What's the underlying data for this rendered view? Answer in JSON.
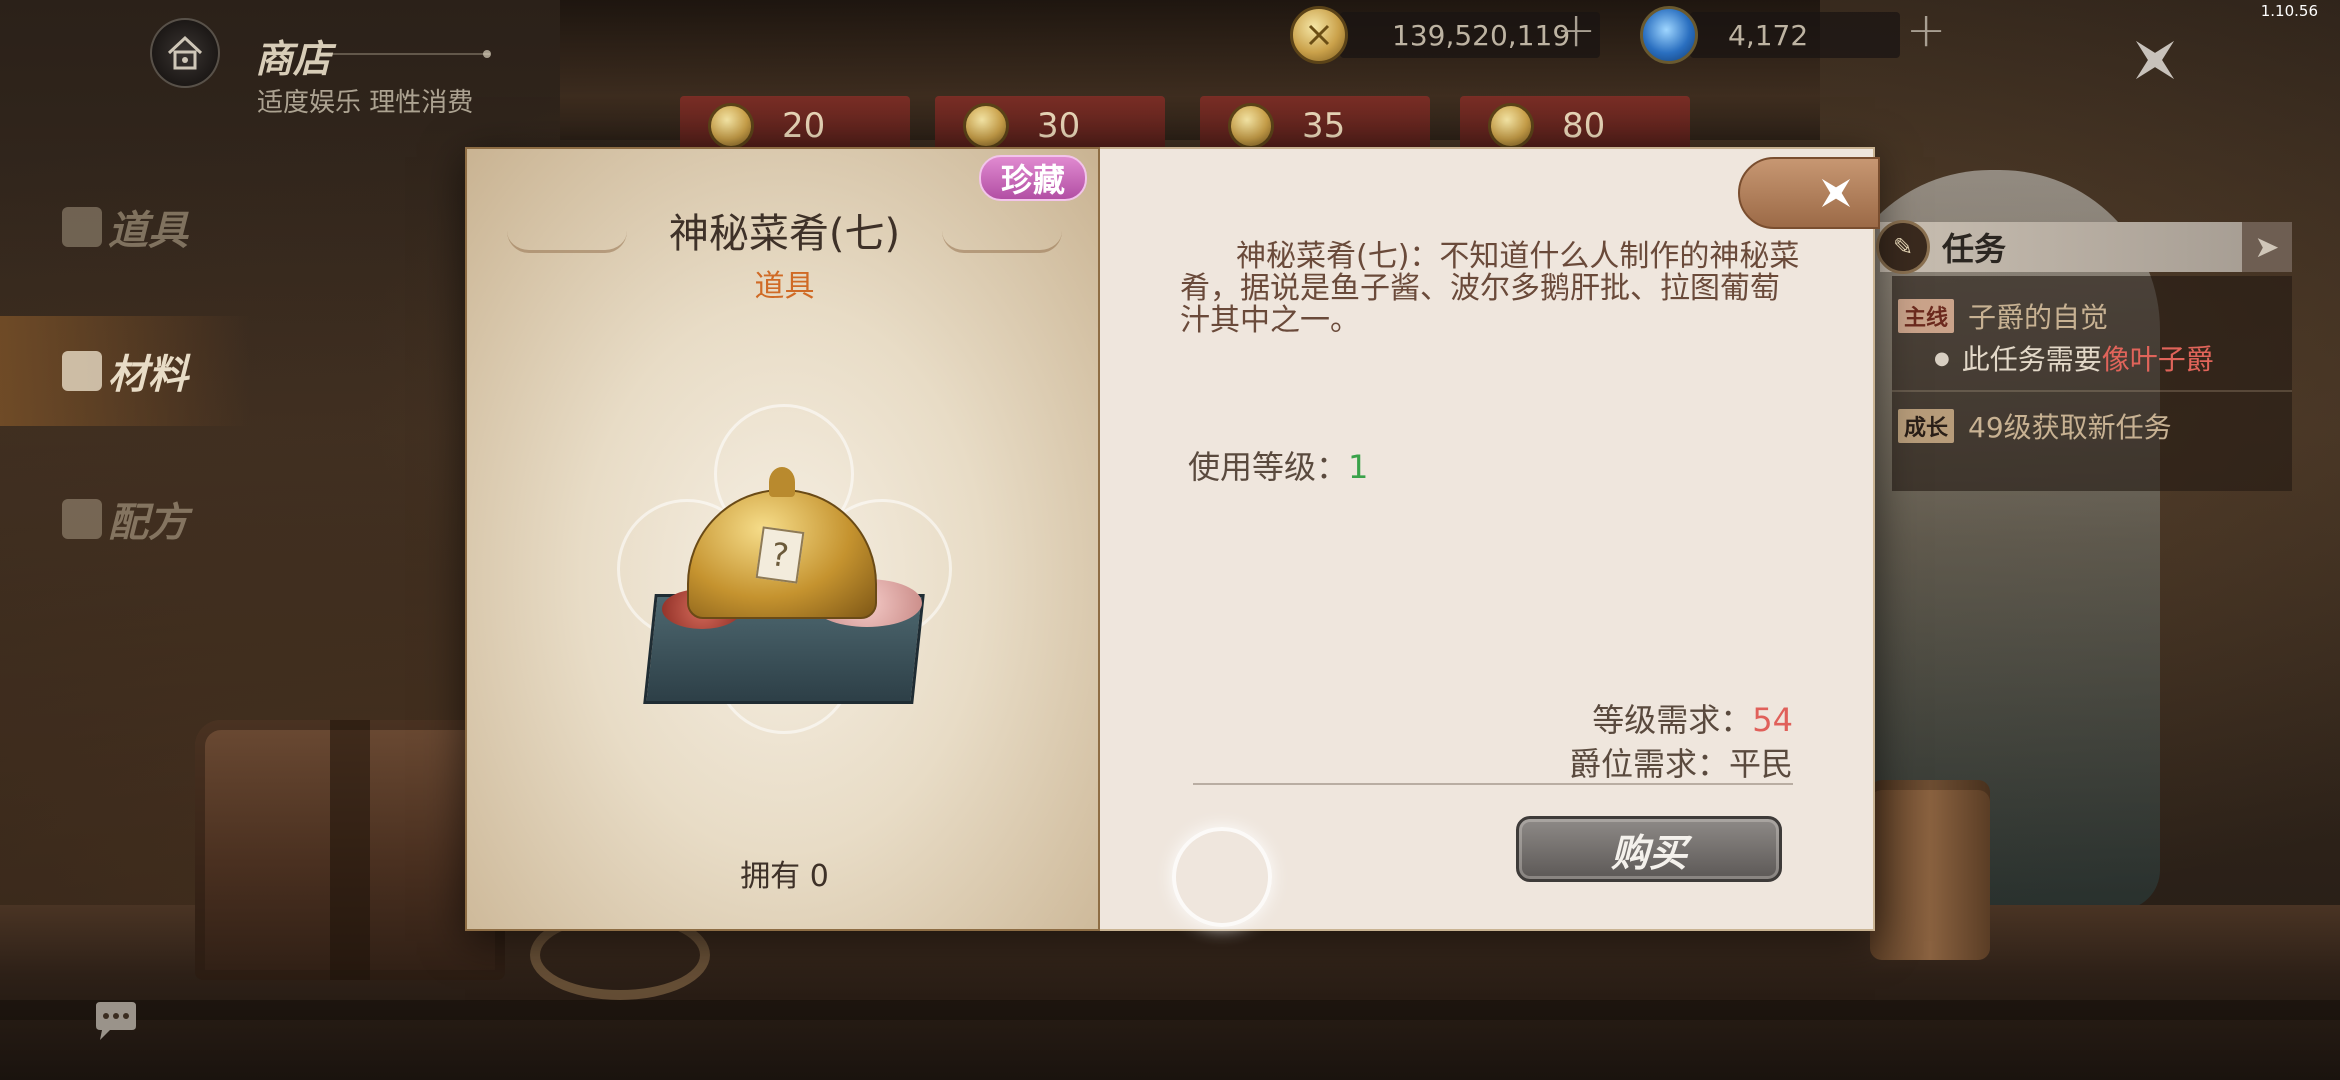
{
  "version": "1.10.56",
  "header": {
    "title": "商店",
    "subtitle": "适度娱乐 理性消费"
  },
  "currency": {
    "gold": "139,520,119",
    "gems": "4,172"
  },
  "price_tabs": [
    "20",
    "30",
    "35",
    "80"
  ],
  "nav": {
    "items": [
      {
        "label": "道具",
        "icon": "bag-icon"
      },
      {
        "label": "材料",
        "icon": "book-icon",
        "active": true
      },
      {
        "label": "配方",
        "icon": "scroll-icon"
      }
    ]
  },
  "task_panel": {
    "title": "任务",
    "main_tag": "主线",
    "main_title": "子爵的自觉",
    "main_sub_prefix": "此任务需要",
    "main_sub_highlight": "像叶子爵",
    "growth_tag": "成长",
    "growth_text": "49级获取新任务"
  },
  "item": {
    "rarity": "珍藏",
    "name": "神秘菜肴(七)",
    "type": "道具",
    "owned": "拥有 0",
    "description": "神秘菜肴(七)：不知道什么人制作的神秘菜肴，据说是鱼子酱、波尔多鹅肝批、拉图葡萄汁其中之一。",
    "use_level_label": "使用等级：",
    "use_level_value": "1",
    "level_req_label": "等级需求：",
    "level_req_value": "54",
    "rank_req_label": "爵位需求：",
    "rank_req_value": "平民",
    "buy_label": "购买"
  },
  "colors": {
    "rarity": "#b24fa4",
    "type": "#d06a25",
    "green": "#3aa24a",
    "red": "#e0605a"
  }
}
